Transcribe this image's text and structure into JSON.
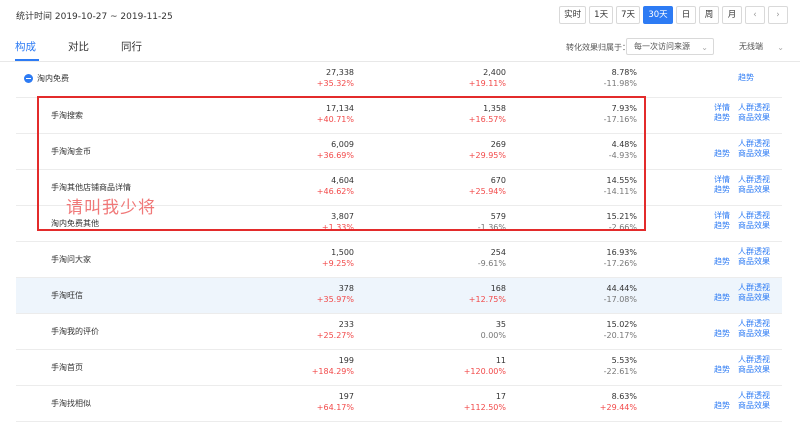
{
  "header": {
    "date_range": "统计时间 2019-10-27 ~ 2019-11-25",
    "periods": [
      "实时",
      "1天",
      "7天",
      "30天",
      "日",
      "周",
      "月"
    ],
    "active_period": "30天",
    "nav_prev": "‹",
    "nav_next": "›"
  },
  "tabs": [
    {
      "label": "构成",
      "active": true
    },
    {
      "label": "对比",
      "active": false
    },
    {
      "label": "同行",
      "active": false
    }
  ],
  "filters": {
    "attribution_label": "转化效果归属于：",
    "attribution_value": "每一次访问来源",
    "device_value": "无线端"
  },
  "rows": [
    {
      "name": "淘内免费",
      "parent": true,
      "v1": "27,338",
      "c1": "+35.32%",
      "v2": "2,400",
      "c2": "+19.11%",
      "v3": "8.78%",
      "c3": "-11.98%",
      "actions": [
        "趋势"
      ]
    },
    {
      "name": "手淘搜索",
      "v1": "17,134",
      "c1": "+40.71%",
      "v2": "1,358",
      "c2": "+16.57%",
      "v3": "7.93%",
      "c3": "-17.16%",
      "actions": [
        "详情",
        "人群透视",
        "趋势",
        "商品效果"
      ]
    },
    {
      "name": "手淘淘金币",
      "v1": "6,009",
      "c1": "+36.69%",
      "v2": "269",
      "c2": "+29.95%",
      "v3": "4.48%",
      "c3": "-4.93%",
      "actions": [
        "",
        "人群透视",
        "趋势",
        "商品效果"
      ]
    },
    {
      "name": "手淘其他店铺商品详情",
      "v1": "4,604",
      "c1": "+46.62%",
      "v2": "670",
      "c2": "+25.94%",
      "v3": "14.55%",
      "c3": "-14.11%",
      "actions": [
        "详情",
        "人群透视",
        "趋势",
        "商品效果"
      ]
    },
    {
      "name": "淘内免费其他",
      "v1": "3,807",
      "c1": "+1.33%",
      "v2": "579",
      "c2": "-1.36%",
      "v3": "15.21%",
      "c3": "-2.66%",
      "actions": [
        "详情",
        "人群透视",
        "趋势",
        "商品效果"
      ]
    },
    {
      "name": "手淘问大家",
      "v1": "1,500",
      "c1": "+9.25%",
      "v2": "254",
      "c2": "-9.61%",
      "v3": "16.93%",
      "c3": "-17.26%",
      "actions": [
        "",
        "人群透视",
        "趋势",
        "商品效果"
      ]
    },
    {
      "name": "手淘旺信",
      "v1": "378",
      "c1": "+35.97%",
      "v2": "168",
      "c2": "+12.75%",
      "v3": "44.44%",
      "c3": "-17.08%",
      "actions": [
        "",
        "人群透视",
        "趋势",
        "商品效果"
      ]
    },
    {
      "name": "手淘我的评价",
      "v1": "233",
      "c1": "+25.27%",
      "v2": "35",
      "c2": "0.00%",
      "v3": "15.02%",
      "c3": "-20.17%",
      "actions": [
        "",
        "人群透视",
        "趋势",
        "商品效果"
      ]
    },
    {
      "name": "手淘首页",
      "v1": "199",
      "c1": "+184.29%",
      "v2": "11",
      "c2": "+120.00%",
      "v3": "5.53%",
      "c3": "-22.61%",
      "actions": [
        "",
        "人群透视",
        "趋势",
        "商品效果"
      ]
    },
    {
      "name": "手淘找相似",
      "v1": "197",
      "c1": "+64.17%",
      "v2": "17",
      "c2": "+112.50%",
      "v3": "8.63%",
      "c3": "+29.44%",
      "actions": [
        "",
        "人群透视",
        "趋势",
        "商品效果"
      ]
    }
  ],
  "watermark": "请叫我少将",
  "colors": {
    "accent": "#2d7bf4",
    "up": "#f24a4a",
    "highlight_box": "#e32b2b"
  }
}
